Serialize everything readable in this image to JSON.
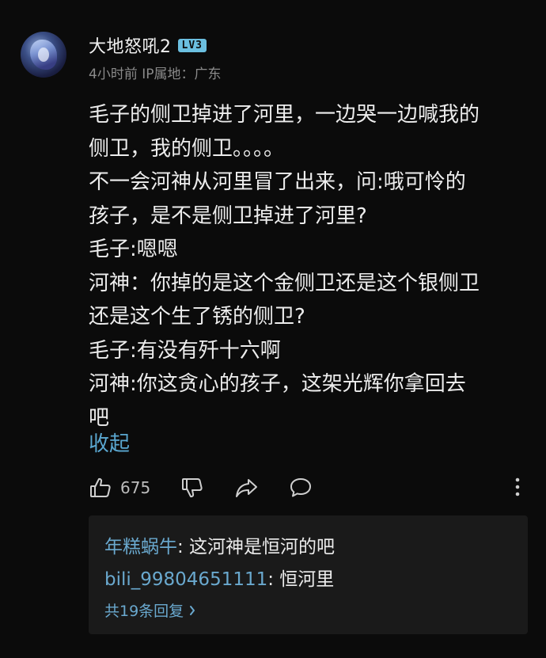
{
  "comment": {
    "username": "大地怒吼2",
    "level_badge": "LV3",
    "sub_info": "4小时前 IP属地：广东",
    "content_lines": [
      "毛子的侧卫掉进了河里，一边哭一边喊我的",
      "侧卫，我的侧卫。。。。",
      "不一会河神从河里冒了出来，问:哦可怜的",
      "孩子，是不是侧卫掉进了河里?",
      "毛子:嗯嗯",
      "河神：你掉的是这个金侧卫还是这个银侧卫",
      "还是这个生了锈的侧卫?",
      "毛子:有没有歼十六啊",
      "河神:你这贪心的孩子，这架光辉你拿回去",
      "吧"
    ],
    "collapse_label": "收起",
    "like_count": "675",
    "icons": {
      "like": "thumbs-up-icon",
      "dislike": "thumbs-down-icon",
      "share": "share-icon",
      "reply": "comment-bubble-icon",
      "more": "more-vertical-icon"
    }
  },
  "replies": {
    "items": [
      {
        "user": "年糕蜗牛",
        "text": ": 这河神是恒河的吧"
      },
      {
        "user": "bili_99804651111",
        "text": ": 恒河里"
      }
    ],
    "count_label": "共19条回复"
  },
  "colors": {
    "background": "#0b0b0b",
    "text": "#ededed",
    "muted": "#8a8a8a",
    "link": "#5aa7d0",
    "reply_panel": "#1a1a1a",
    "badge": "#6bbfe0"
  }
}
